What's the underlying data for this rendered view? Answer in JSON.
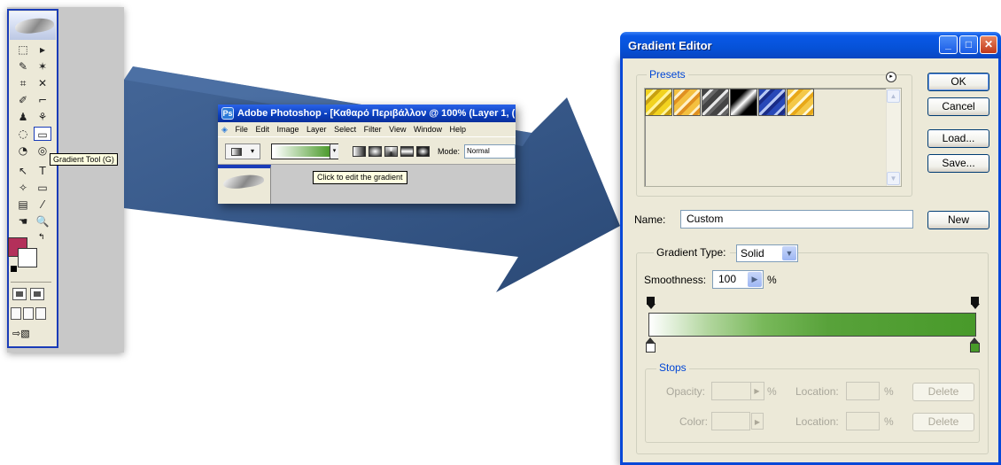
{
  "toolbox": {
    "tools": [
      "⬚",
      "▸",
      "✎",
      "✶",
      "⌗",
      "✕",
      "✐",
      "⌐",
      "♟",
      "⚘",
      "◌",
      "▭",
      "◔",
      "◎",
      "↖",
      "T",
      "✧",
      "▭",
      "▤",
      "⁄",
      "☚",
      "🔍"
    ],
    "fg_color": "#b3305a",
    "bg_color": "#ffffff",
    "tooltip": "Gradient Tool (G)"
  },
  "photoshop": {
    "title": "Adobe Photoshop - [Καθαρό Περιβάλλον @ 100% (Layer 1, (",
    "menu": [
      "File",
      "Edit",
      "Image",
      "Layer",
      "Select",
      "Filter",
      "View",
      "Window",
      "Help"
    ],
    "mode_label": "Mode:",
    "mode_value": "Normal",
    "tooltip": "Click to edit the gradient"
  },
  "gradient_editor": {
    "title": "Gradient Editor",
    "presets_label": "Presets",
    "buttons": {
      "ok": "OK",
      "cancel": "Cancel",
      "load": "Load...",
      "save": "Save...",
      "new": "New"
    },
    "name_label": "Name:",
    "name_value": "Custom",
    "gradient_type_label": "Gradient Type:",
    "gradient_type_value": "Solid",
    "smoothness_label": "Smoothness:",
    "smoothness_value": "100",
    "smoothness_unit": "%",
    "gradient_colors": [
      "#ffffff",
      "#489a2a"
    ],
    "stops": {
      "legend": "Stops",
      "opacity_label": "Opacity:",
      "color_label": "Color:",
      "location_label": "Location:",
      "percent": "%",
      "delete_label": "Delete"
    }
  }
}
